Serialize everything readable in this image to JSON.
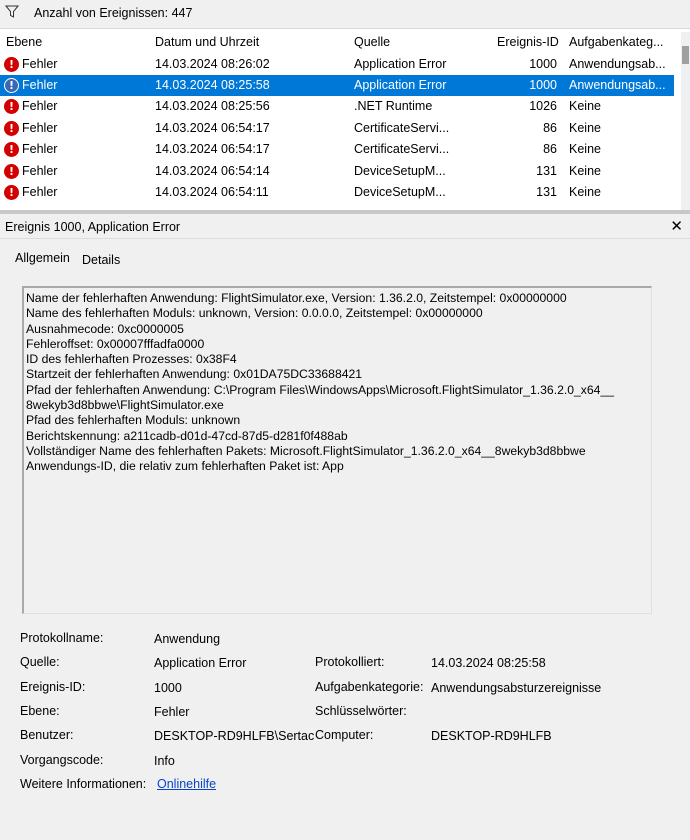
{
  "filter": {
    "icon": "filter-icon",
    "count_label": "Anzahl von Ereignissen: 447"
  },
  "columns": [
    "Ebene",
    "Datum und Uhrzeit",
    "Quelle",
    "Ereignis-ID",
    "Aufgabenkateg..."
  ],
  "rows": [
    {
      "level": "Fehler",
      "date": "14.03.2024 08:26:02",
      "source": "Application Error",
      "id": "1000",
      "task": "Anwendungsab..."
    },
    {
      "level": "Fehler",
      "date": "14.03.2024 08:25:58",
      "source": "Application Error",
      "id": "1000",
      "task": "Anwendungsab..."
    },
    {
      "level": "Fehler",
      "date": "14.03.2024 08:25:56",
      "source": ".NET Runtime",
      "id": "1026",
      "task": "Keine"
    },
    {
      "level": "Fehler",
      "date": "14.03.2024 06:54:17",
      "source": "CertificateServi...",
      "id": "86",
      "task": "Keine"
    },
    {
      "level": "Fehler",
      "date": "14.03.2024 06:54:17",
      "source": "CertificateServi...",
      "id": "86",
      "task": "Keine"
    },
    {
      "level": "Fehler",
      "date": "14.03.2024 06:54:14",
      "source": "DeviceSetupM...",
      "id": "131",
      "task": "Keine"
    },
    {
      "level": "Fehler",
      "date": "14.03.2024 06:54:11",
      "source": "DeviceSetupM...",
      "id": "131",
      "task": "Keine"
    }
  ],
  "selected_row": 1,
  "event": {
    "title": "Ereignis 1000, Application Error",
    "close": "✕",
    "tabs": {
      "general": "Allgemein",
      "details": "Details"
    },
    "description": "Name der fehlerhaften Anwendung: FlightSimulator.exe, Version: 1.36.2.0, Zeitstempel: 0x00000000\nName des fehlerhaften Moduls: unknown, Version: 0.0.0.0, Zeitstempel: 0x00000000\nAusnahmecode: 0xc0000005\nFehleroffset: 0x00007fffadfa0000\nID des fehlerhaften Prozesses: 0x38F4\nStartzeit der fehlerhaften Anwendung: 0x01DA75DC33688421\nPfad der fehlerhaften Anwendung: C:\\Program Files\\WindowsApps\\Microsoft.FlightSimulator_1.36.2.0_x64__\n8wekyb3d8bbwe\\FlightSimulator.exe\nPfad des fehlerhaften Moduls: unknown\nBerichtskennung: a211cadb-d01d-47cd-87d5-d281f0f488ab\nVollständiger Name des fehlerhaften Pakets: Microsoft.FlightSimulator_1.36.2.0_x64__8wekyb3d8bbwe\nAnwendungs-ID, die relativ zum fehlerhaften Paket ist: App",
    "props": {
      "log_label": "Protokollname:",
      "log_value": "Anwendung",
      "source_label": "Quelle:",
      "source_value": "Application Error",
      "logged_label": "Protokolliert:",
      "logged_value": "14.03.2024 08:25:58",
      "id_label": "Ereignis-ID:",
      "id_value": "1000",
      "task_label": "Aufgabenkategorie:",
      "task_value": "Anwendungsabsturzereignisse",
      "level_label": "Ebene:",
      "level_value": "Fehler",
      "keywords_label": "Schlüsselwörter:",
      "keywords_value": "",
      "user_label": "Benutzer:",
      "user_value": "DESKTOP-RD9HLFB\\Sertac",
      "computer_label": "Computer:",
      "computer_value": "DESKTOP-RD9HLFB",
      "opcode_label": "Vorgangscode:",
      "opcode_value": "Info",
      "moreinfo_label": "Weitere Informationen:",
      "moreinfo_link": "Onlinehilfe"
    }
  },
  "colors": {
    "selection": "#0078d7",
    "error": "#d20000",
    "link": "#0645c8"
  }
}
